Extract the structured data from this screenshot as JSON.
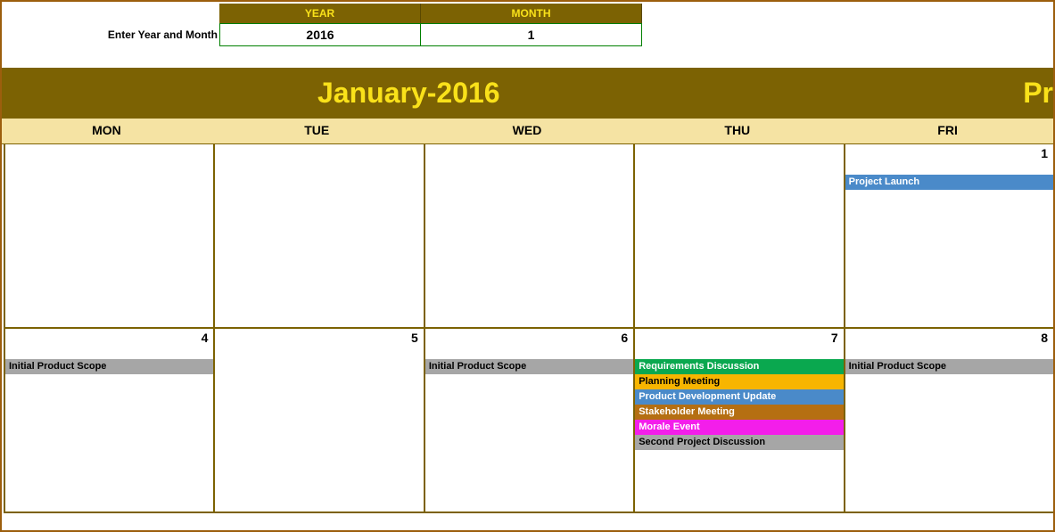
{
  "input": {
    "label": "Enter Year and Month",
    "year_header": "YEAR",
    "month_header": "MONTH",
    "year_value": "2016",
    "month_value": "1"
  },
  "title": "January-2016",
  "title_right": "Pr",
  "days": {
    "d0": "MON",
    "d1": "TUE",
    "d2": "WED",
    "d3": "THU",
    "d4": "FRI"
  },
  "week1": {
    "fri": {
      "num": "1",
      "ev0": "Project Launch"
    }
  },
  "week2": {
    "mon": {
      "num": "4",
      "ev0": "Initial Product Scope"
    },
    "tue": {
      "num": "5"
    },
    "wed": {
      "num": "6",
      "ev0": "Initial Product Scope"
    },
    "thu": {
      "num": "7",
      "ev0": "Requirements Discussion",
      "ev1": "Planning Meeting",
      "ev2": "Product Development Update",
      "ev3": "Stakeholder Meeting",
      "ev4": "Morale Event",
      "ev5": "Second Project Discussion"
    },
    "fri": {
      "num": "8",
      "ev0": "Initial Product Scope"
    }
  }
}
